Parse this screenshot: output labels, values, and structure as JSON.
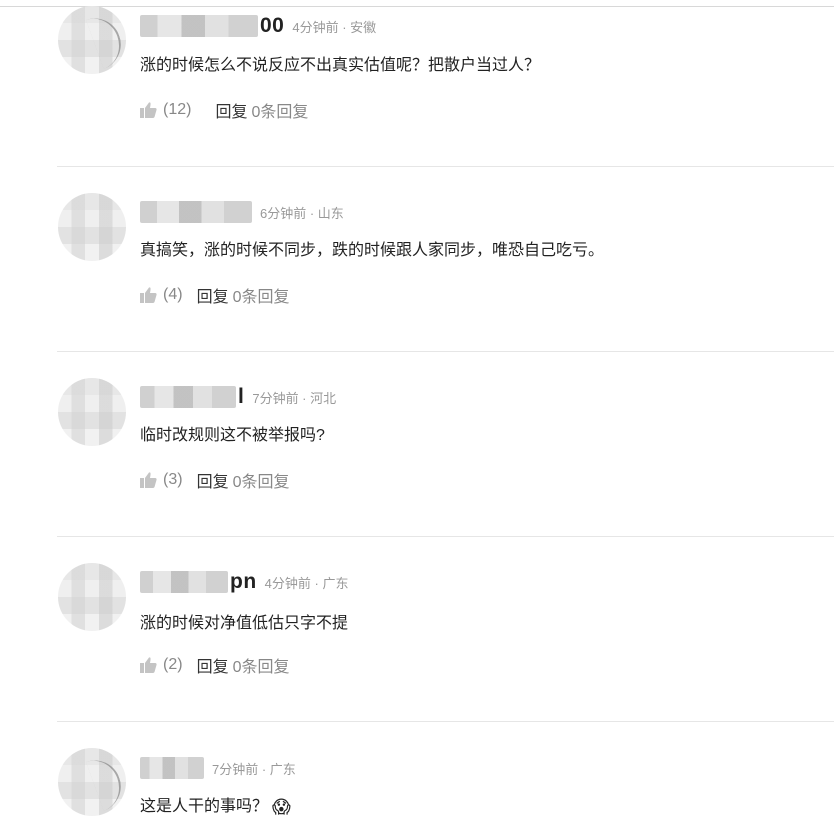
{
  "comments": [
    {
      "name_suffix": "00",
      "meta": "4分钟前 · 安徽",
      "text": "涨的时候怎么不说反应不出真实估值呢？把散户当过人？",
      "likes": "(12)",
      "reply_label": "回复",
      "reply_count": "0条回复",
      "avatar_style": "logo"
    },
    {
      "name_suffix": "",
      "meta": "6分钟前 · 山东",
      "text": "真搞笑，涨的时候不同步，跌的时候跟人家同步，唯恐自己吃亏。",
      "likes": "(4)",
      "reply_label": "回复",
      "reply_count": "0条回复",
      "avatar_style": "plain"
    },
    {
      "name_suffix": "l",
      "meta": "7分钟前 · 河北",
      "text": "临时改规则这不被举报吗?",
      "likes": "(3)",
      "reply_label": "回复",
      "reply_count": "0条回复",
      "avatar_style": "plain"
    },
    {
      "name_suffix": "pn",
      "meta": "4分钟前 · 广东",
      "text": "涨的时候对净值低估只字不提",
      "likes": "(2)",
      "reply_label": "回复",
      "reply_count": "0条回复",
      "avatar_style": "plain"
    },
    {
      "name_suffix": "",
      "meta": "7分钟前 · 广东",
      "text": "这是人干的事吗？",
      "emoji": "😱",
      "likes": "",
      "reply_label": "",
      "reply_count": "",
      "avatar_style": "logo"
    }
  ],
  "icons": {
    "like": "thumbs-up-icon",
    "emoji": "screaming-face-emoji"
  },
  "colors": {
    "text": "#222222",
    "meta": "#999999",
    "divider": "#e6e6e6",
    "action": "#888888"
  }
}
